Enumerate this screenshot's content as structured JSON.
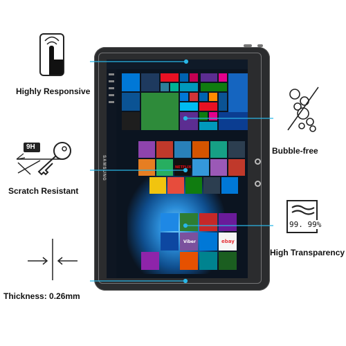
{
  "features": {
    "responsive": "Highly Responsive",
    "bubble": "Bubble-free",
    "scratch": "Scratch Resistant",
    "transparency": "High Transparency",
    "thickness": "Thickness: 0.26mm"
  },
  "hardness_badge": "9H",
  "transparency_value": "99. 99%",
  "device": {
    "brand": "SAMSUNG",
    "tiles": {
      "netflix": "NETFLIX",
      "viber": "Viber",
      "ebay": "ebay"
    }
  },
  "colors": {
    "accent_line": "#29b6e6",
    "tablet_body": "#2b2c2e",
    "screen_bg": "#0b1420",
    "label_text": "#111111"
  }
}
